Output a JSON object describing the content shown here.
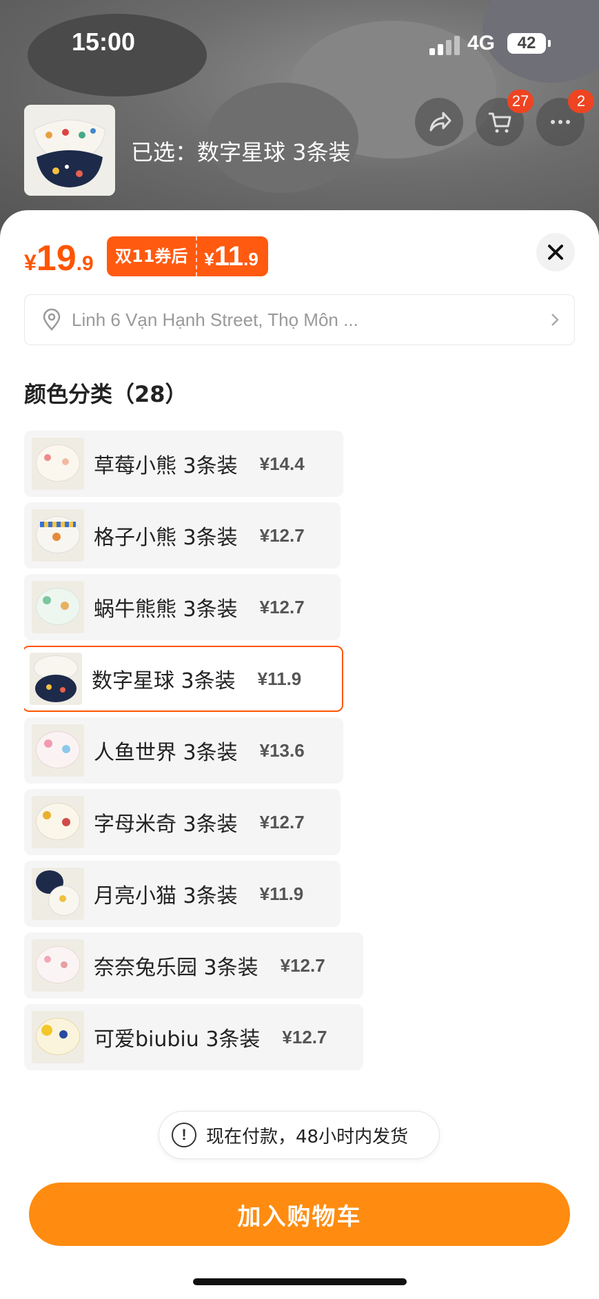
{
  "status_bar": {
    "time": "15:00",
    "network": "4G",
    "battery": "42"
  },
  "header": {
    "selected_label": "已选：数字星球 3条装",
    "cart_badge": "27",
    "more_badge": "2",
    "icons": [
      "share-icon",
      "cart-icon",
      "more-icon"
    ]
  },
  "price": {
    "currency": "¥",
    "integer": "19",
    "decimal": ".9",
    "color": "#ff5500"
  },
  "coupon": {
    "label": "双11券后",
    "currency": "¥",
    "integer": "11",
    "decimal": ".9"
  },
  "address": {
    "text": "Linh 6 Vạn Hạnh Street, Thọ Môn ..."
  },
  "variants_section": {
    "title": "颜色分类（28）",
    "items": [
      {
        "name": "草莓小熊 3条装",
        "price": "¥14.4",
        "selected": false
      },
      {
        "name": "格子小熊 3条装",
        "price": "¥12.7",
        "selected": false
      },
      {
        "name": "蜗牛熊熊 3条装",
        "price": "¥12.7",
        "selected": false
      },
      {
        "name": "数字星球 3条装",
        "price": "¥11.9",
        "selected": true
      },
      {
        "name": "人鱼世界 3条装",
        "price": "¥13.6",
        "selected": false
      },
      {
        "name": "字母米奇 3条装",
        "price": "¥12.7",
        "selected": false
      },
      {
        "name": "月亮小猫 3条装",
        "price": "¥11.9",
        "selected": false
      },
      {
        "name": "奈奈兔乐园 3条装",
        "price": "¥12.7",
        "selected": false
      },
      {
        "name": "可爱biubiu 3条装",
        "price": "¥12.7",
        "selected": false
      }
    ]
  },
  "toast": {
    "icon": "exclamation-icon",
    "text": "现在付款，48小时内发货"
  },
  "actions": {
    "add_to_cart": "加入购物车",
    "button_color": "#ff8c10"
  }
}
